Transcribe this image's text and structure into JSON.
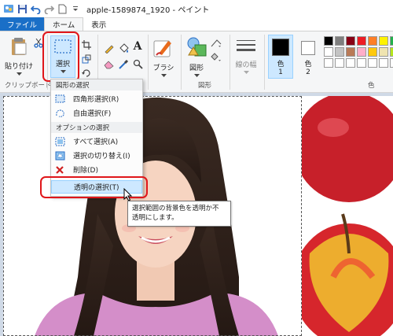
{
  "window": {
    "title": "apple-1589874_1920 - ペイント"
  },
  "tabs": [
    {
      "label": "ファイル"
    },
    {
      "label": "ホーム"
    },
    {
      "label": "表示"
    }
  ],
  "ribbon": {
    "clipboard": {
      "paste_label": "貼り付け",
      "group_label": "クリップボード"
    },
    "select": {
      "label": "選択"
    },
    "brush": {
      "label": "ブラシ"
    },
    "shapes": {
      "label": "図形",
      "group_label": "図形"
    },
    "line_width": {
      "label": "線の幅"
    },
    "color1": {
      "label": "色",
      "num": "1"
    },
    "color2": {
      "label": "色",
      "num": "2"
    },
    "colors_group_label": "色",
    "palette": [
      "#000000",
      "#7f7f7f",
      "#880015",
      "#ed1c24",
      "#ff7f27",
      "#fff200",
      "#22b14c",
      "#00a2e8",
      "#ffffff",
      "#c3c3c3",
      "#b97a57",
      "#ffaec9",
      "#ffc90e",
      "#efe4b0",
      "#b5e61d",
      "#99d9ea",
      "#ffffff",
      "#ffffff",
      "#ffffff",
      "#ffffff",
      "#ffffff",
      "#ffffff",
      "#ffffff",
      "#ffffff"
    ]
  },
  "menu": {
    "header1": "図形の選択",
    "rect_select": "四角形選択(R)",
    "free_select": "自由選択(F)",
    "header2": "オプションの選択",
    "select_all": "すべて選択(A)",
    "invert": "選択の切り替え(I)",
    "delete": "削除(D)",
    "transparent": "透明の選択(T)"
  },
  "tooltip": {
    "line1": "選択範囲の背景色を透明か不",
    "line2": "透明にします。"
  },
  "colors": {
    "accent": "#1a6fc7",
    "highlight": "#e0161a",
    "hover": "#cde8ff"
  }
}
